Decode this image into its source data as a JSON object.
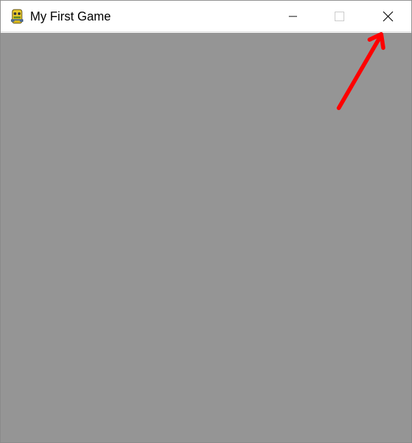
{
  "window": {
    "title": "My First Game",
    "app_icon": "pygame-snake-icon",
    "client_background": "#959595"
  },
  "caption_buttons": {
    "minimize": {
      "icon": "minimize-icon"
    },
    "maximize": {
      "icon": "maximize-icon"
    },
    "close": {
      "icon": "close-icon"
    }
  },
  "annotation": {
    "type": "arrow",
    "color": "#ff0000",
    "target": "close-button"
  }
}
